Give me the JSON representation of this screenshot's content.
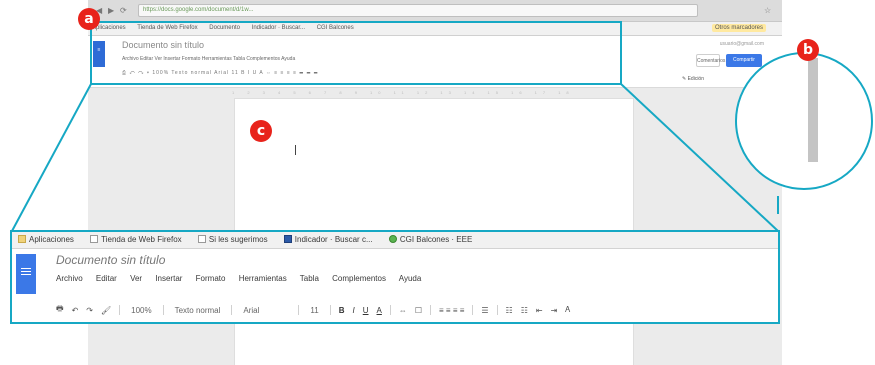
{
  "small_shot": {
    "address_text": "https://docs.google.com/document/d/1w...",
    "bookmarks": [
      "Aplicaciones",
      "Tienda de Web Firefox",
      "Documento",
      "Indicador · Buscar...",
      "CGI Balcones"
    ],
    "extension_label": "Otros marcadores",
    "doc_title": "Documento sin título",
    "menu_text": "Archivo  Editar  Ver  Insertar  Formato  Herramientas  Tabla  Complementos  Ayuda",
    "toolbar_text": "⎙ ↶ ↷ ▾  100%   Texto normal   Arial   11   B I U A   ⇔   ≡ ≡ ≡ ≡   ☰  ☰  ☰",
    "user_label": "usuario@gmail.com",
    "comments_label": "Comentarios",
    "share_label": "Compartir",
    "edit_label": "✎ Edición",
    "ruler_text": "1 2 3 4 5 6 7 8 9 10 11 12 13 14 15 16 17 18"
  },
  "zoom": {
    "bookmarks": [
      {
        "label": "Aplicaciones",
        "icon": "apps-grid-icon"
      },
      {
        "label": "Tienda de Web Firefox",
        "icon": "page-icon"
      },
      {
        "label": "Si les sugerimos",
        "icon": "page-icon"
      },
      {
        "label": "Indicador · Buscar c...",
        "icon": "bookmark-blue-icon"
      },
      {
        "label": "CGI Balcones · EEE",
        "icon": "globe-icon"
      }
    ],
    "doc_title": "Documento sin título",
    "menu": [
      "Archivo",
      "Editar",
      "Ver",
      "Insertar",
      "Formato",
      "Herramientas",
      "Tabla",
      "Complementos",
      "Ayuda"
    ],
    "toolbar": {
      "print": "🖶",
      "undo": "↶",
      "redo": "↷",
      "paint_format": "🖌",
      "zoom": "100%",
      "style": "Texto normal",
      "font": "Arial",
      "size": "11",
      "bold": "B",
      "italic": "I",
      "underline": "U",
      "text_color": "A",
      "link": "⇔",
      "comment": "☐",
      "align": "≡ ≡ ≡ ≡",
      "line_spacing": "☰",
      "numbered_list": "☷",
      "bulleted_list": "☷",
      "indent_less": "⇤",
      "indent_more": "⇥",
      "clear": "Ꭺ"
    }
  },
  "markers": {
    "a": "a",
    "b": "b",
    "c": "c"
  },
  "colors": {
    "callout": "#16a8c4",
    "marker": "#e8231b",
    "docs_blue": "#3b78e7"
  }
}
